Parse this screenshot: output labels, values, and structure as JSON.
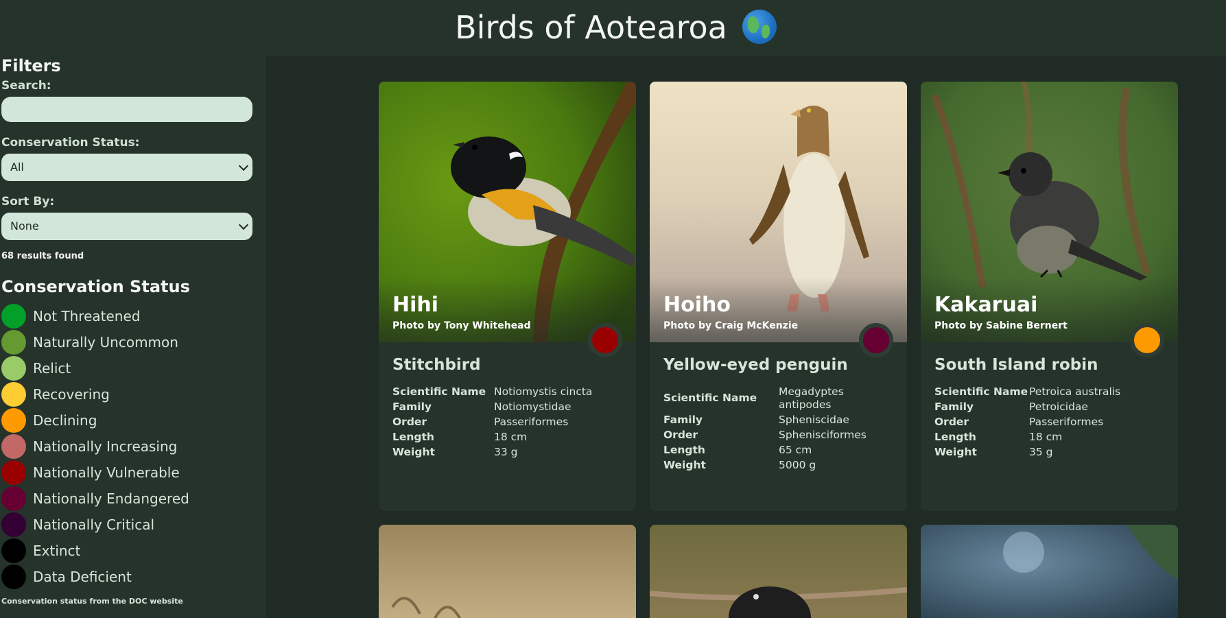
{
  "header": {
    "title": "Birds of Aotearoa",
    "emoji": "globe-icon"
  },
  "filters": {
    "heading": "Filters",
    "search_label": "Search:",
    "search_value": "",
    "status_label": "Conservation Status:",
    "status_value": "All",
    "sort_label": "Sort By:",
    "sort_value": "None",
    "results": "68 results found"
  },
  "legend": {
    "title": "Conservation Status",
    "items": [
      {
        "label": "Not Threatened",
        "color": "#02a028"
      },
      {
        "label": "Naturally Uncommon",
        "color": "#649a31"
      },
      {
        "label": "Relict",
        "color": "#99cb68"
      },
      {
        "label": "Recovering",
        "color": "#fecc33"
      },
      {
        "label": "Declining",
        "color": "#fe9a01"
      },
      {
        "label": "Nationally Increasing",
        "color": "#c26967"
      },
      {
        "label": "Nationally Vulnerable",
        "color": "#9b0000"
      },
      {
        "label": "Nationally Endangered",
        "color": "#660032"
      },
      {
        "label": "Nationally Critical",
        "color": "#320033"
      },
      {
        "label": "Extinct",
        "color": "#000000"
      },
      {
        "label": "Data Deficient",
        "color": "#000000"
      }
    ],
    "credit": "Conservation status from the DOC website"
  },
  "cards": [
    {
      "name": "Hihi",
      "photo_credit": "Photo by Tony Whitehead",
      "status_color": "#9b0000",
      "common": "Stitchbird",
      "facts": [
        {
          "k": "Scientific Name",
          "v": "Notiomystis cincta"
        },
        {
          "k": "Family",
          "v": "Notiomystidae"
        },
        {
          "k": "Order",
          "v": "Passeriformes"
        },
        {
          "k": "Length",
          "v": "18 cm"
        },
        {
          "k": "Weight",
          "v": "33 g"
        }
      ]
    },
    {
      "name": "Hoiho",
      "photo_credit": "Photo by Craig McKenzie",
      "status_color": "#660032",
      "common": "Yellow-eyed penguin",
      "facts": [
        {
          "k": "Scientific Name",
          "v": "Megadyptes antipodes"
        },
        {
          "k": "Family",
          "v": "Spheniscidae"
        },
        {
          "k": "Order",
          "v": "Sphenisciformes"
        },
        {
          "k": "Length",
          "v": "65 cm"
        },
        {
          "k": "Weight",
          "v": "5000 g"
        }
      ]
    },
    {
      "name": "Kakaruai",
      "photo_credit": "Photo by Sabine Bernert",
      "status_color": "#fe9a01",
      "common": "South Island robin",
      "facts": [
        {
          "k": "Scientific Name",
          "v": "Petroica australis"
        },
        {
          "k": "Family",
          "v": "Petroicidae"
        },
        {
          "k": "Order",
          "v": "Passeriformes"
        },
        {
          "k": "Length",
          "v": "18 cm"
        },
        {
          "k": "Weight",
          "v": "35 g"
        }
      ]
    }
  ]
}
